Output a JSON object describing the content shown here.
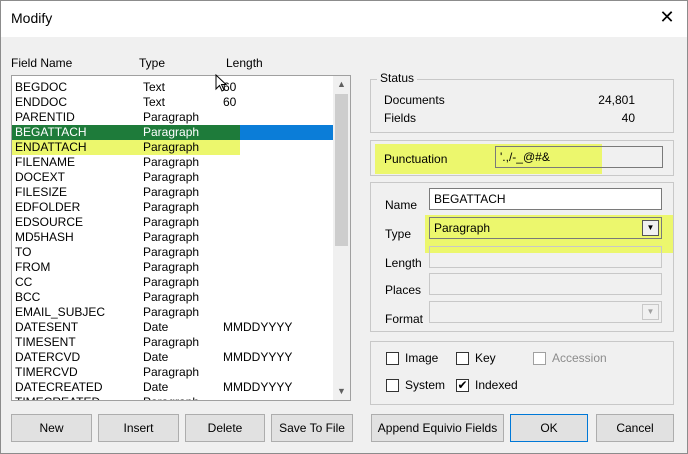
{
  "window": {
    "title": "Modify",
    "close_glyph": "✕"
  },
  "list": {
    "headers": [
      "Field Name",
      "Type",
      "Length"
    ],
    "rows": [
      [
        "BEGDOC",
        "Text",
        "60"
      ],
      [
        "ENDDOC",
        "Text",
        "60"
      ],
      [
        "PARENTID",
        "Paragraph",
        ""
      ],
      [
        "BEGATTACH",
        "Paragraph",
        ""
      ],
      [
        "ENDATTACH",
        "Paragraph",
        ""
      ],
      [
        "FILENAME",
        "Paragraph",
        ""
      ],
      [
        "DOCEXT",
        "Paragraph",
        ""
      ],
      [
        "FILESIZE",
        "Paragraph",
        ""
      ],
      [
        "EDFOLDER",
        "Paragraph",
        ""
      ],
      [
        "EDSOURCE",
        "Paragraph",
        ""
      ],
      [
        "MD5HASH",
        "Paragraph",
        ""
      ],
      [
        "TO",
        "Paragraph",
        ""
      ],
      [
        "FROM",
        "Paragraph",
        ""
      ],
      [
        "CC",
        "Paragraph",
        ""
      ],
      [
        "BCC",
        "Paragraph",
        ""
      ],
      [
        "EMAIL_SUBJEC",
        "Paragraph",
        ""
      ],
      [
        "DATESENT",
        "Date",
        "MMDDYYYY"
      ],
      [
        "TIMESENT",
        "Paragraph",
        ""
      ],
      [
        "DATERCVD",
        "Date",
        "MMDDYYYY"
      ],
      [
        "TIMERCVD",
        "Paragraph",
        ""
      ],
      [
        "DATECREATED",
        "Date",
        "MMDDYYYY"
      ],
      [
        "TIMECREATED",
        "Paragraph",
        ""
      ]
    ],
    "selected_index": 3,
    "highlighted_index": 4
  },
  "status": {
    "label": "Status",
    "documents_label": "Documents",
    "documents_value": "24,801",
    "fields_label": "Fields",
    "fields_value": "40"
  },
  "punctuation": {
    "label": "Punctuation",
    "value": "'.,/-_@#&"
  },
  "field": {
    "name_label": "Name",
    "name_value": "BEGATTACH",
    "type_label": "Type",
    "type_value": "Paragraph",
    "length_label": "Length",
    "places_label": "Places",
    "format_label": "Format"
  },
  "options": {
    "image": {
      "label": "Image",
      "checked": false
    },
    "key": {
      "label": "Key",
      "checked": false
    },
    "accession": {
      "label": "Accession",
      "checked": false
    },
    "system": {
      "label": "System",
      "checked": false
    },
    "indexed": {
      "label": "Indexed",
      "checked": true
    },
    "check_glyph": "✔"
  },
  "buttons": {
    "new": "New",
    "insert": "Insert",
    "delete": "Delete",
    "save_to_file": "Save To File",
    "append": "Append Equivio Fields",
    "ok": "OK",
    "cancel": "Cancel"
  },
  "icons": {
    "close": "close-icon",
    "dropdown": "chevron-down-icon",
    "cursor": "mouse-pointer-icon"
  },
  "colors": {
    "selection": "#0b7dd8",
    "selection_highlight": "#1e7b3a",
    "annotation_yellow": "#ecf76d"
  }
}
